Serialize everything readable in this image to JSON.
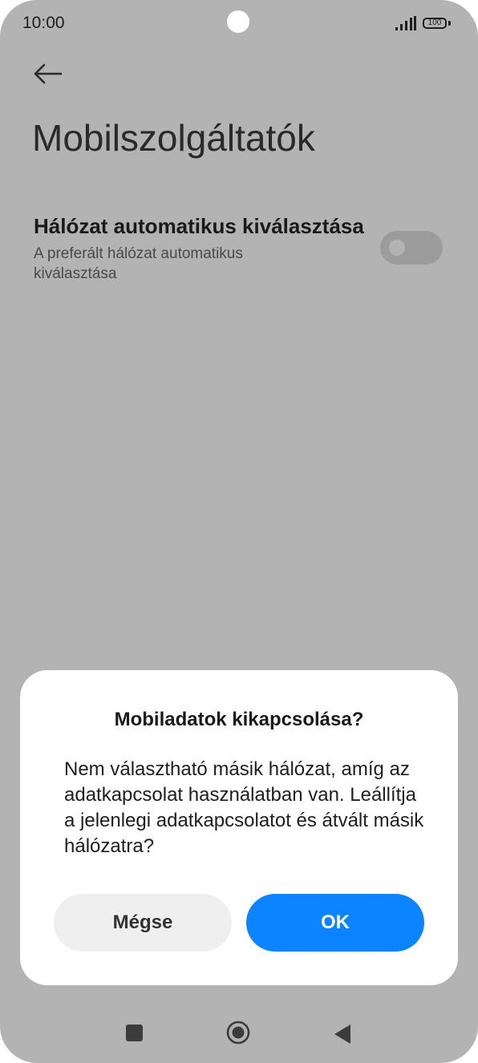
{
  "status_bar": {
    "time": "10:00",
    "battery": "100",
    "icons": [
      "signal-icon",
      "battery-icon"
    ]
  },
  "header": {
    "back_icon": "arrow-left-icon",
    "title": "Mobilszolgáltatók"
  },
  "setting": {
    "title": "Hálózat automatikus kiválasztása",
    "subtitle": "A preferált hálózat automatikus kiválasztása",
    "toggle_on": false
  },
  "dialog": {
    "title": "Mobiladatok kikapcsolása?",
    "message": "Nem választható másik hálózat, amíg az adatkapcsolat használatban van. Leállítja a jelenlegi adatkapcsolatot és átvált másik hálózatra?",
    "cancel_label": "Mégse",
    "ok_label": "OK"
  },
  "nav_bar": {
    "icons": [
      "recent-apps-icon",
      "home-icon",
      "back-icon"
    ]
  },
  "colors": {
    "scrim": "#b3b3b3",
    "dialog_bg": "#ffffff",
    "accent": "#0d84ff",
    "cancel_bg": "#efefef"
  }
}
